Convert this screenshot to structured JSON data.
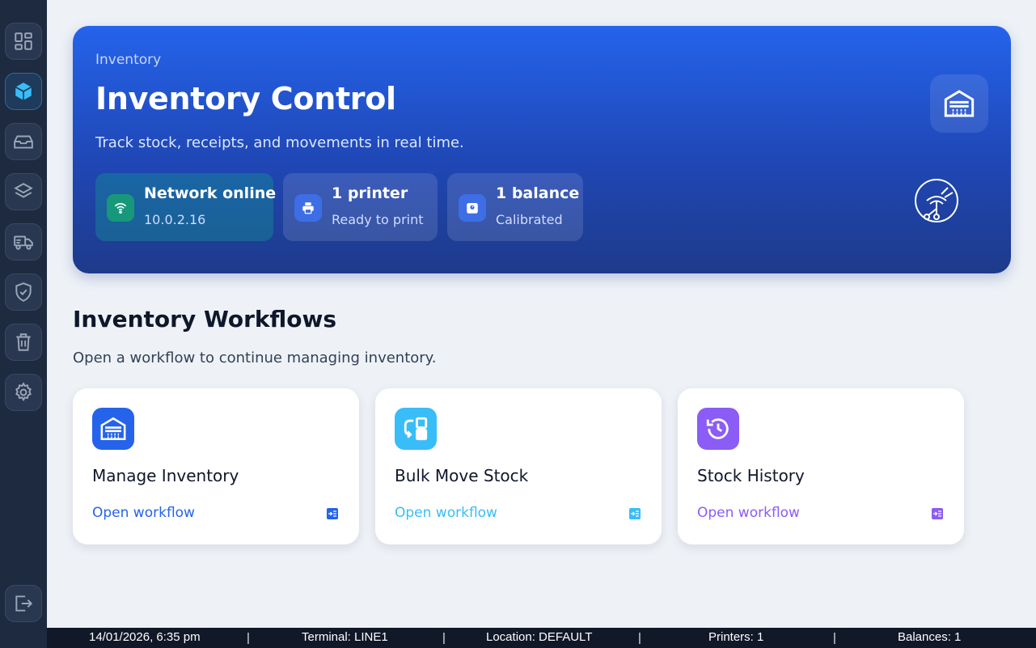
{
  "sidebar": {
    "items": [
      {
        "name": "dashboard",
        "icon": "dashboard-grid-icon"
      },
      {
        "name": "inventory",
        "icon": "cube-icon",
        "active": true
      },
      {
        "name": "tray",
        "icon": "tray-icon"
      },
      {
        "name": "layers",
        "icon": "layers-icon"
      },
      {
        "name": "shipping",
        "icon": "truck-icon"
      },
      {
        "name": "quality",
        "icon": "shield-check-icon"
      },
      {
        "name": "waste",
        "icon": "trash-icon"
      },
      {
        "name": "settings",
        "icon": "gear-icon"
      }
    ],
    "logout_icon": "logout-icon"
  },
  "hero": {
    "breadcrumb": "Inventory",
    "title": "Inventory Control",
    "subtitle": "Track stock, receipts, and movements in real time.",
    "chips": {
      "network": {
        "title": "Network online",
        "sub": "10.0.2.16"
      },
      "printer": {
        "title": "1 printer",
        "sub": "Ready to print"
      },
      "balance": {
        "title": "1 balance",
        "sub": "Calibrated"
      }
    }
  },
  "workflows": {
    "title": "Inventory Workflows",
    "subtitle": "Open a workflow to continue managing inventory.",
    "cards": [
      {
        "title": "Manage Inventory",
        "link": "Open workflow",
        "accent": "#2563eb"
      },
      {
        "title": "Bulk Move Stock",
        "link": "Open workflow",
        "accent": "#38bdf8"
      },
      {
        "title": "Stock History",
        "link": "Open workflow",
        "accent": "#8b5cf6"
      }
    ]
  },
  "status_bar": {
    "datetime": "14/01/2026, 6:35 pm",
    "terminal": "Terminal: LINE1",
    "location": "Location: DEFAULT",
    "printers": "Printers: 1",
    "balances": "Balances: 1",
    "separator": "|"
  }
}
